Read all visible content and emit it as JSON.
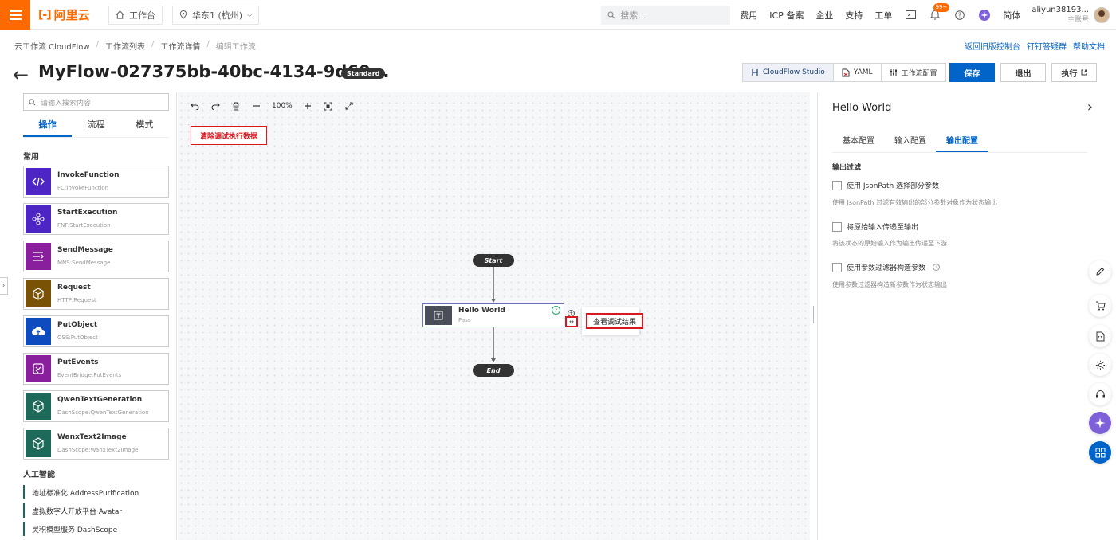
{
  "topbar": {
    "logo_mark": "[-]",
    "logo_text": "阿里云",
    "workbench": "工作台",
    "region": "华东1 (杭州)",
    "search_placeholder": "搜索...",
    "links": [
      "费用",
      "ICP 备案",
      "企业",
      "支持",
      "工单"
    ],
    "notification_count": "99+",
    "language": "简体",
    "user_name": "aliyun38193...",
    "user_role": "主账号"
  },
  "breadcrumb": [
    "云工作流 CloudFlow",
    "工作流列表",
    "工作流详情",
    "编辑工作流"
  ],
  "top_links": [
    "返回旧版控制台",
    "钉钉答疑群",
    "帮助文档"
  ],
  "title": {
    "name": "MyFlow-027375bb-40bc-4134-9d60...",
    "badge": "Standard"
  },
  "modes": [
    {
      "label": "CloudFlow Studio",
      "icon": "flow-icon"
    },
    {
      "label": "YAML",
      "icon": "yaml-icon"
    },
    {
      "label": "工作流配置",
      "icon": "sliders-icon"
    }
  ],
  "actions_bar": {
    "save": "保存",
    "exit": "退出",
    "run": "执行"
  },
  "left_panel": {
    "search_placeholder": "请输入搜索内容",
    "tabs": [
      "操作",
      "流程",
      "模式"
    ],
    "common_title": "常用",
    "items": [
      {
        "name": "InvokeFunction",
        "sub": "FC:InvokeFunction",
        "color": "#4d25c4",
        "icon": "code-icon"
      },
      {
        "name": "StartExecution",
        "sub": "FNF:StartExecution",
        "color": "#4d25c4",
        "icon": "flow-nodes-icon"
      },
      {
        "name": "SendMessage",
        "sub": "MNS:SendMessage",
        "color": "#8a1f9e",
        "icon": "message-icon"
      },
      {
        "name": "Request",
        "sub": "HTTP:Request",
        "color": "#7a5206",
        "icon": "cube-icon"
      },
      {
        "name": "PutObject",
        "sub": "OSS:PutObject",
        "color": "#0d4bbf",
        "icon": "cloud-upload-icon"
      },
      {
        "name": "PutEvents",
        "sub": "EventBridge:PutEvents",
        "color": "#8a1f9e",
        "icon": "events-icon"
      },
      {
        "name": "QwenTextGeneration",
        "sub": "DashScope:QwenTextGeneration",
        "color": "#1e6a5a",
        "icon": "cube-icon"
      },
      {
        "name": "WanxText2Image",
        "sub": "DashScope:WanxText2Image",
        "color": "#1e6a5a",
        "icon": "cube-icon"
      }
    ],
    "ai_title": "人工智能",
    "ai_items": [
      "地址标准化 AddressPurification",
      "虚拟数字人开放平台 Avatar",
      "灵积模型服务 DashScope"
    ]
  },
  "canvas": {
    "zoom": "100%",
    "clear_button": "清除调试执行数据",
    "start_label": "Start",
    "end_label": "End",
    "node": {
      "name": "Hello World",
      "sub": "Pass",
      "status": "success"
    },
    "popover_label": "查看调试结果"
  },
  "right_panel": {
    "title": "Hello World",
    "tabs": [
      "基本配置",
      "输入配置",
      "输出配置"
    ],
    "active_tab": "输出配置",
    "section": "输出过滤",
    "options": [
      {
        "label": "使用 JsonPath 选择部分参数",
        "desc": "使用 JsonPath 过滤有效输出的部分参数对象作为状态输出"
      },
      {
        "label": "将原始输入传递至输出",
        "desc": "将该状态的原始输入作为输出传递至下游"
      },
      {
        "label": "使用参数过滤器构造参数",
        "desc": "使用参数过滤器构造新参数作为状态输出"
      }
    ]
  },
  "colors": {
    "brand": "#ff6a00",
    "primary": "#0064c8",
    "highlight": "#d9171f"
  }
}
